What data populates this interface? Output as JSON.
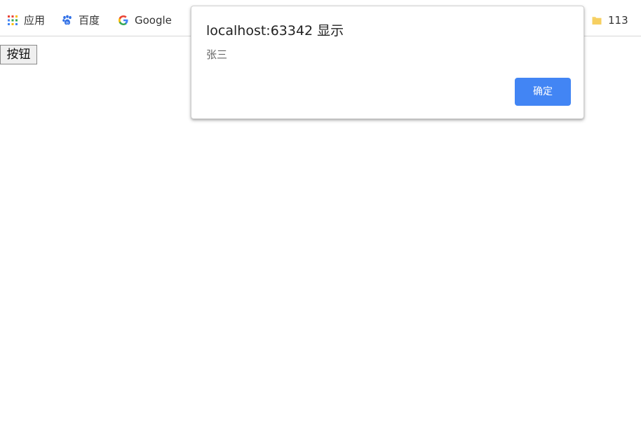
{
  "bookmarks": {
    "apps": {
      "label": "应用",
      "icon": "apps-grid-icon"
    },
    "baidu": {
      "label": "百度",
      "icon": "baidu-paw-icon"
    },
    "google": {
      "label": "Google",
      "icon": "google-g-icon"
    },
    "folder": {
      "label": "113",
      "icon": "folder-icon"
    }
  },
  "page": {
    "button_label": "按钮"
  },
  "alert": {
    "title": "localhost:63342 显示",
    "message": "张三",
    "confirm_label": "确定"
  },
  "colors": {
    "accent": "#4285f4",
    "folder": "#f8d775"
  }
}
